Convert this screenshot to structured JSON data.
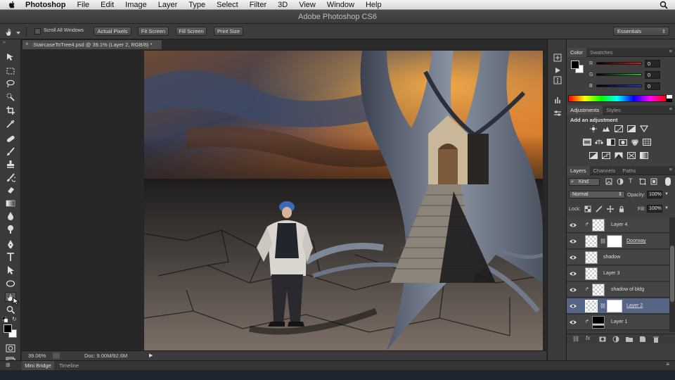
{
  "menubar": {
    "app": "Photoshop",
    "items": [
      "File",
      "Edit",
      "Image",
      "Layer",
      "Type",
      "Select",
      "Filter",
      "3D",
      "View",
      "Window",
      "Help"
    ]
  },
  "window": {
    "title": "Adobe Photoshop CS6"
  },
  "options": {
    "scroll_all": "Scroll All Windows",
    "actual_pixels": "Actual Pixels",
    "fit_screen": "Fit Screen",
    "fill_screen": "Fill Screen",
    "print_size": "Print Size",
    "workspace": "Essentials"
  },
  "document": {
    "tab_label": "StaircaseToTree4.psd @ 39.1% (Layer 2, RGB/8) *",
    "zoom": "39.06%",
    "doc_size": "Doc: 9.00M/92.6M"
  },
  "bottom_tabs": [
    "Mini Bridge",
    "Timeline"
  ],
  "color_panel": {
    "tabs": [
      "Color",
      "Swatches"
    ],
    "channels": [
      {
        "label": "R",
        "value": "0"
      },
      {
        "label": "G",
        "value": "0"
      },
      {
        "label": "B",
        "value": "0"
      }
    ]
  },
  "adjustments_panel": {
    "tabs": [
      "Adjustments",
      "Styles"
    ],
    "heading": "Add an adjustment"
  },
  "layers_panel": {
    "tabs": [
      "Layers",
      "Channels",
      "Paths"
    ],
    "filter_kind": "Kind",
    "blend_mode": "Normal",
    "opacity_label": "Opacity:",
    "opacity": "100%",
    "lock_label": "Lock:",
    "fill_label": "Fill:",
    "fill": "100%",
    "layers": [
      {
        "name": "Layer 4",
        "clipped": true,
        "mask": false,
        "selected": false
      },
      {
        "name": "Doorway",
        "clipped": false,
        "mask": true,
        "selected": false
      },
      {
        "name": "shadow",
        "clipped": false,
        "mask": false,
        "selected": false
      },
      {
        "name": "Layer 3",
        "clipped": false,
        "mask": false,
        "selected": false
      },
      {
        "name": "shadow of bldg",
        "clipped": true,
        "mask": false,
        "selected": false
      },
      {
        "name": "Layer 2",
        "clipped": false,
        "mask": true,
        "selected": true
      },
      {
        "name": "Layer 1",
        "clipped": true,
        "mask": false,
        "selected": false
      }
    ]
  },
  "colors": {
    "accent_selected": "#566586",
    "red_slider": "#d62020",
    "green_slider": "#20b020",
    "blue_slider": "#2030d0"
  }
}
